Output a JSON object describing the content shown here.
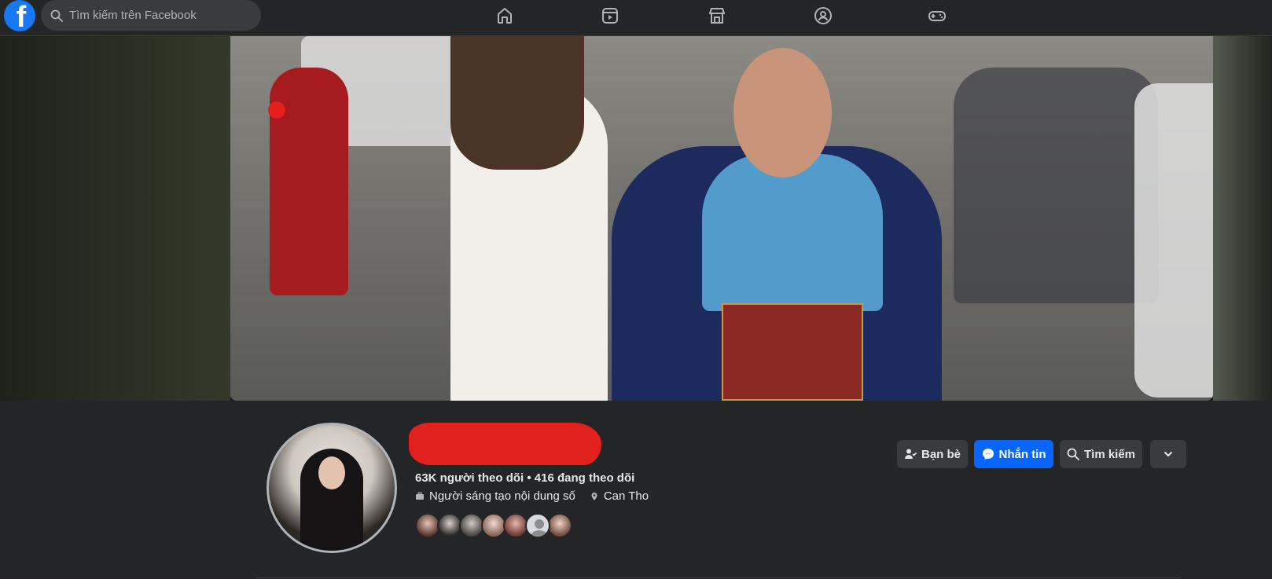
{
  "topbar": {
    "logo_letter": "f",
    "search_placeholder": "Tìm kiếm trên Facebook",
    "nav_icons": [
      "home-icon",
      "video-icon",
      "marketplace-icon",
      "groups-icon",
      "gaming-icon"
    ]
  },
  "profile": {
    "stats": "63K người theo dõi • 416 đang theo dõi",
    "category": "Người sáng tạo nội dung số",
    "location": "Can Tho"
  },
  "actions": {
    "friends_label": "Bạn bè",
    "message_label": "Nhắn tin",
    "search_label": "Tìm kiếm"
  },
  "colors": {
    "brand": "#1877f2",
    "primary_button": "#0866ff",
    "background": "#242526",
    "redaction": "#e0211d"
  }
}
